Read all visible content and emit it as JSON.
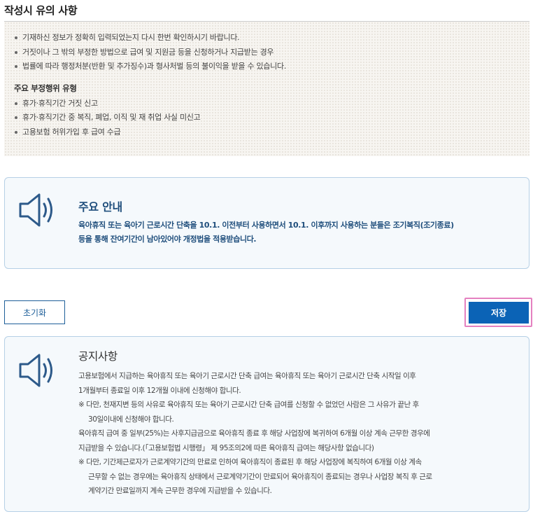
{
  "caution": {
    "title": "작성시 유의 사항",
    "items": [
      "기재하신 정보가 정확히 입력되었는지 다시 한번 확인하시기 바랍니다.",
      "거짓이나 그 밖의 부정한 방법으로 급여 및 지원금 등을 신청하거나 지급받는 경우",
      "법률에 따라 행정처분(반환 및 추가징수)과 형사처벌 등의 불이익을 받을 수 있습니다."
    ],
    "fraud_heading": "주요 부정행위 유형",
    "fraud_items": [
      "휴가·휴직기간 거짓 신고",
      "휴가·휴직기간 중 복직, 폐업, 이직 및 재 취업 사실 미신고",
      "고용보험 허위가입 후 급여 수급"
    ]
  },
  "main_notice": {
    "title": "주요 안내",
    "lines": [
      "육아휴직 또는 육아기 근로시간 단축을 10.1. 이전부터 사용하면서 10.1. 이후까지 사용하는 분들은 조기복직(조기종료)",
      "등을 통해 잔여기간이 남아있어야 개정법을 적용받습니다."
    ]
  },
  "buttons": {
    "reset": "초기화",
    "save": "저장"
  },
  "public_notice": {
    "title": "공지사항",
    "lines": [
      "고용보험에서 지급하는 육아휴직 또는 육아기 근로시간 단축 급여는 육아휴직 또는 육아기 근로시간 단축 시작일 이후",
      "1개월부터 종료일 이후 12개월 이내에 신청해야 합니다.",
      "※ 다만, 천재지변 등의 사유로 육아휴직 또는 육아기 근로시간 단축 급여를 신청할 수 없었던 사람은 그 사유가 끝난 후",
      "30일이내에 신청해야 합니다.",
      "육아휴직 급여 중 일부(25%)는 사후지급금으로 육아휴직 종료 후 해당 사업장에 복귀하여 6개월 이상 계속 근무한 경우에",
      "지급받을 수 있습니다.(「고용보험법 시행령」 제 95조의2에 따른 육아휴직 급여는 해당사항 없습니다)",
      "※ 다만, 기간제근로자가 근로계약기간의 만료로 인하여 육아휴직이 종료된 후 해당 사업장에 복직하여 6개월 이상 계속",
      "근무할 수 없는 경우에는 육아휴직 상태에서 근로계약기간이 만료되어 육아휴직이 종료되는 경우나 사업장 복직 후 근로",
      "계약기간 만료일까지 계속 근무한 경우에 지급받을 수 있습니다."
    ]
  },
  "colors": {
    "accent": "#0b63b6",
    "notice_title": "#1f4e7c",
    "highlight_outline": "#e481c0"
  },
  "icons": {
    "notice_icon": "speaker-icon"
  }
}
